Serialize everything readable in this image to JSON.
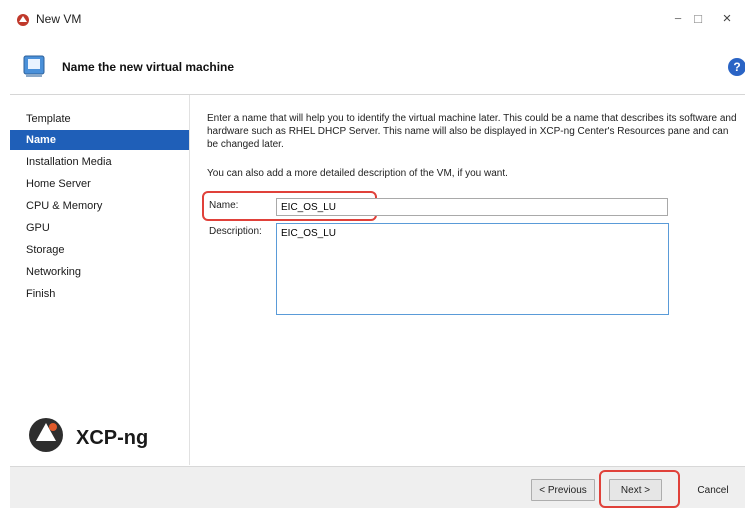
{
  "window": {
    "title": "New VM",
    "minimize": "−",
    "maximize": "□",
    "close": "×"
  },
  "header": {
    "title": "Name the new virtual machine",
    "help": "?"
  },
  "sidebar": {
    "items": [
      {
        "label": "Template"
      },
      {
        "label": "Name",
        "active": true
      },
      {
        "label": "Installation Media"
      },
      {
        "label": "Home Server"
      },
      {
        "label": "CPU & Memory"
      },
      {
        "label": "GPU"
      },
      {
        "label": "Storage"
      },
      {
        "label": "Networking"
      },
      {
        "label": "Finish"
      }
    ],
    "brand": "XCP-ng"
  },
  "main": {
    "intro": "Enter a name that will help you to identify the virtual machine later. This could be a name that describes its software and hardware such as RHEL DHCP Server. This name will also be displayed in XCP-ng Center's Resources pane and can be changed later.",
    "intro2": "You can also add a more detailed description of the VM, if you want.",
    "name_label": "Name:",
    "name_value": "EIC_OS_LU",
    "description_label": "Description:",
    "description_value": "EIC_OS_LU"
  },
  "footer": {
    "previous": "< Previous",
    "next": "Next >",
    "cancel": "Cancel"
  },
  "colors": {
    "accent": "#1f5fb8",
    "highlight": "#e0413a",
    "help": "#2a64c5"
  }
}
